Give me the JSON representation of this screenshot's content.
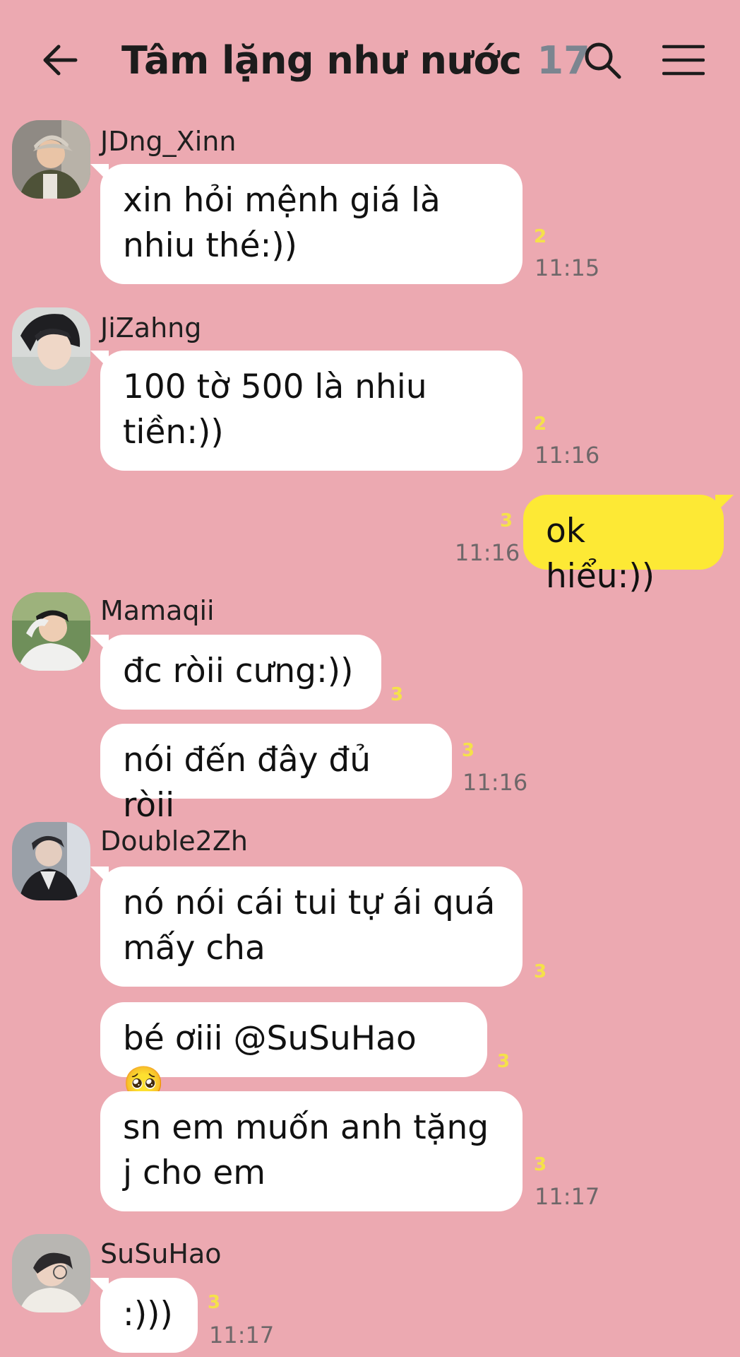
{
  "header": {
    "title": "Tâm lặng như nước",
    "member_count": "17",
    "back_icon": "arrow-left-icon",
    "search_icon": "search-icon",
    "menu_icon": "hamburger-menu-icon"
  },
  "colors": {
    "background": "#eca9b1",
    "incoming_bubble": "#ffffff",
    "outgoing_bubble": "#fde935",
    "unread_count": "#f5e14a",
    "timestamp": "#6e6769"
  },
  "messages": [
    {
      "sender": "JDng_Xinn",
      "text": "xin hỏi mệnh giá là nhiu thé:))",
      "unread": "2",
      "time": "11:15"
    },
    {
      "sender": "JiZahng",
      "text": "100 tờ 500 là nhiu tiền:))",
      "unread": "2",
      "time": "11:16"
    },
    {
      "sender": "me",
      "text": "ok hiểu:))",
      "unread": "3",
      "time": "11:16"
    },
    {
      "sender": "Mamaqii",
      "text": "đc ròii cưng:))",
      "unread": "3"
    },
    {
      "sender": "Mamaqii",
      "text": "nói đến đây đủ ròii",
      "unread": "3",
      "time": "11:16"
    },
    {
      "sender": "Double2Zh",
      "text": "nó nói cái tui tự ái quá mấy cha",
      "unread": "3"
    },
    {
      "sender": "Double2Zh",
      "text": "bé ơiii @SuSuHao 🥺",
      "unread": "3"
    },
    {
      "sender": "Double2Zh",
      "text": "sn em muốn anh tặng j cho em",
      "unread": "3",
      "time": "11:17"
    },
    {
      "sender": "SuSuHao",
      "text": ":)))",
      "unread": "3",
      "time": "11:17"
    }
  ]
}
